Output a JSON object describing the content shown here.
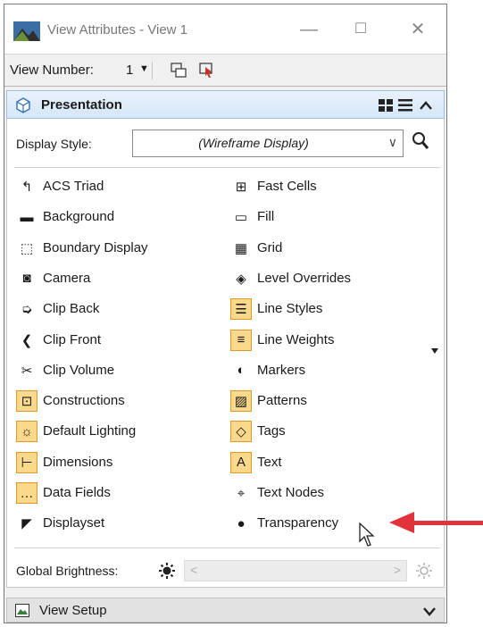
{
  "window": {
    "title": "View Attributes - View 1"
  },
  "toolbar": {
    "view_number_label": "View Number:",
    "view_number_value": "1"
  },
  "section": {
    "title": "Presentation"
  },
  "display_style": {
    "label": "Display Style:",
    "value": "(Wireframe Display)"
  },
  "left_items": [
    {
      "label": "ACS Triad",
      "icon": "acs-triad-icon",
      "active": false,
      "glyph": "↰"
    },
    {
      "label": "Background",
      "icon": "background-icon",
      "active": false,
      "glyph": "▬"
    },
    {
      "label": "Boundary Display",
      "icon": "boundary-display-icon",
      "active": false,
      "glyph": "⬚"
    },
    {
      "label": "Camera",
      "icon": "camera-icon",
      "active": false,
      "glyph": "◙"
    },
    {
      "label": "Clip Back",
      "icon": "clip-back-icon",
      "active": false,
      "glyph": "➭"
    },
    {
      "label": "Clip Front",
      "icon": "clip-front-icon",
      "active": false,
      "glyph": "❮"
    },
    {
      "label": "Clip Volume",
      "icon": "clip-volume-icon",
      "active": false,
      "glyph": "✂"
    },
    {
      "label": "Constructions",
      "icon": "constructions-icon",
      "active": true,
      "glyph": "⊡"
    },
    {
      "label": "Default Lighting",
      "icon": "default-lighting-icon",
      "active": true,
      "glyph": "☼"
    },
    {
      "label": "Dimensions",
      "icon": "dimensions-icon",
      "active": true,
      "glyph": "⊢"
    },
    {
      "label": "Data Fields",
      "icon": "data-fields-icon",
      "active": true,
      "glyph": "…"
    },
    {
      "label": "Displayset",
      "icon": "displayset-icon",
      "active": false,
      "glyph": "◤"
    }
  ],
  "right_items": [
    {
      "label": "Fast Cells",
      "icon": "fast-cells-icon",
      "active": false,
      "glyph": "⊞"
    },
    {
      "label": "Fill",
      "icon": "fill-icon",
      "active": false,
      "glyph": "▭"
    },
    {
      "label": "Grid",
      "icon": "grid-icon",
      "active": false,
      "glyph": "▦"
    },
    {
      "label": "Level Overrides",
      "icon": "level-overrides-icon",
      "active": false,
      "glyph": "◈"
    },
    {
      "label": "Line Styles",
      "icon": "line-styles-icon",
      "active": true,
      "glyph": "☰"
    },
    {
      "label": "Line Weights",
      "icon": "line-weights-icon",
      "active": true,
      "glyph": "≡"
    },
    {
      "label": "Markers",
      "icon": "markers-icon",
      "active": false,
      "glyph": "◐"
    },
    {
      "label": "Patterns",
      "icon": "patterns-icon",
      "active": true,
      "glyph": "▨"
    },
    {
      "label": "Tags",
      "icon": "tags-icon",
      "active": true,
      "glyph": "◇"
    },
    {
      "label": "Text",
      "icon": "text-icon",
      "active": true,
      "glyph": "A"
    },
    {
      "label": "Text Nodes",
      "icon": "text-nodes-icon",
      "active": false,
      "glyph": "⌖"
    },
    {
      "label": "Transparency",
      "icon": "transparency-icon",
      "active": false,
      "glyph": "●"
    }
  ],
  "brightness": {
    "label": "Global Brightness:"
  },
  "footer": {
    "title": "View Setup"
  },
  "colors": {
    "accent": "#e0333b",
    "active_bg": "#fbd98c",
    "header_bg": "#d5e6f7"
  }
}
